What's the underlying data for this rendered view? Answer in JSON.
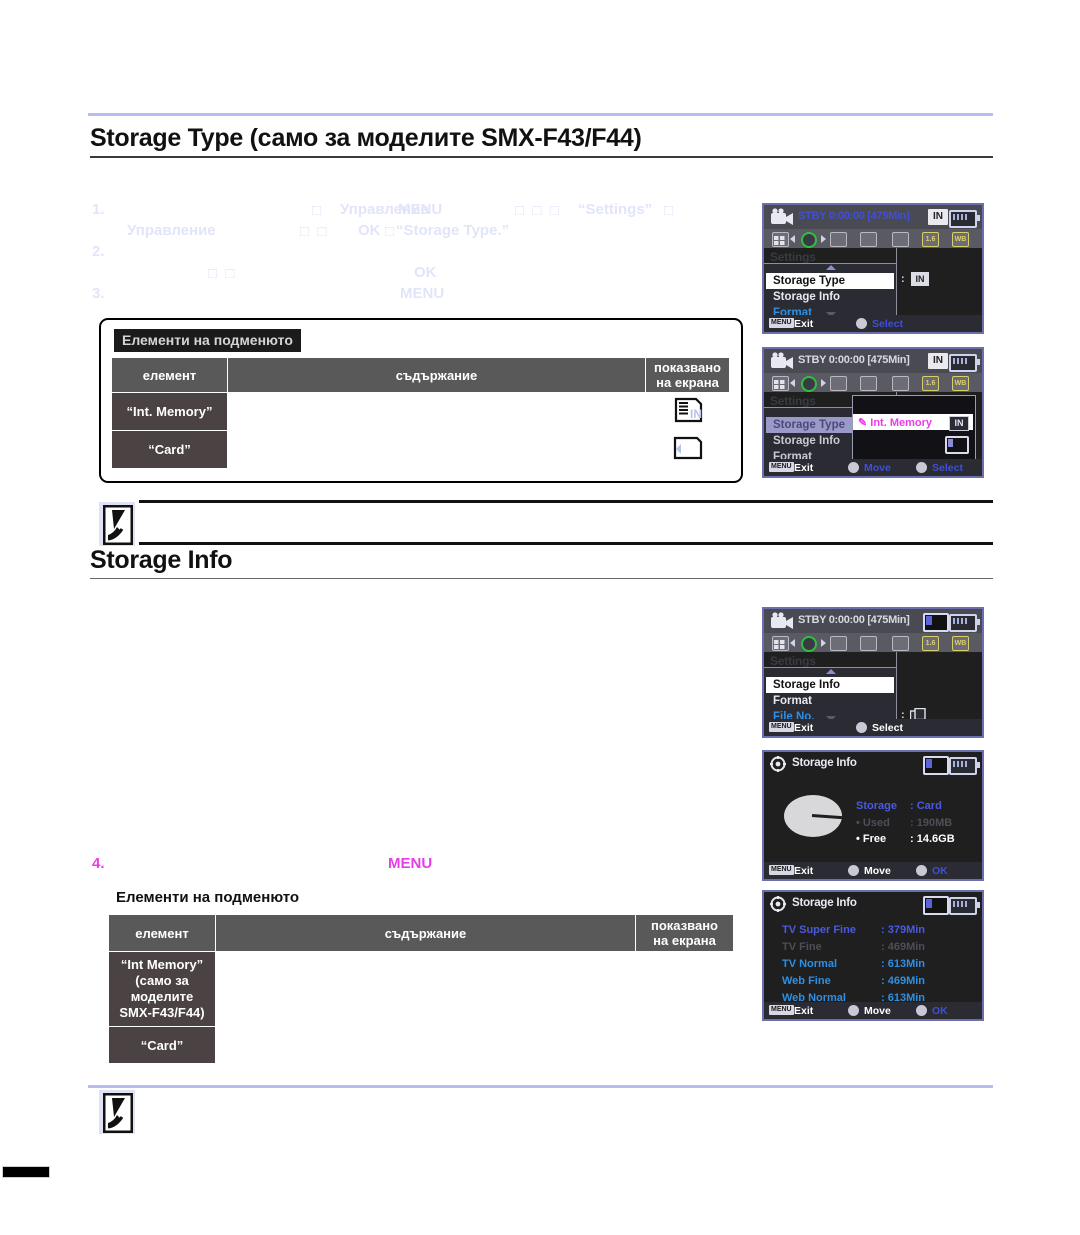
{
  "page": {
    "section1_title": "Storage Type (само за моделите SMX-F43/F44)",
    "section2_title": "Storage Info"
  },
  "steps": [
    {
      "num": "1.",
      "t1": "Управление",
      "t2": "MENU",
      "t3": "“Settings”",
      "t4": "□"
    },
    {
      "num": "",
      "t1": "Управление",
      "t2": "OK",
      "t3": "“Storage Type.”",
      "t4": ""
    },
    {
      "num": "2.",
      "t1": "",
      "t2": "OK",
      "t3": "",
      "t4": ""
    },
    {
      "num": "3.",
      "t1": "",
      "t2": "MENU",
      "t3": "",
      "t4": ""
    },
    {
      "num": "4.",
      "t1": "",
      "t2": "MENU",
      "t3": "",
      "t4": ""
    }
  ],
  "submenu_top": {
    "tag": "Елементи на подменюто",
    "headers": {
      "item": "елемент",
      "content": "съдържание",
      "display": "показвано\nна екрана"
    },
    "header_display_line1": "показвано",
    "header_display_line2": "на екрана",
    "rows": [
      {
        "item": "“Int. Memory”",
        "content": "",
        "icon": "internal-memory-icon"
      },
      {
        "item": "“Card”",
        "content": "",
        "icon": "memory-card-icon"
      }
    ]
  },
  "submenu_bottom": {
    "title": "Елементи на подменюто",
    "headers": {
      "item": "елемент",
      "content": "съдържание"
    },
    "header_display_line1": "показвано",
    "header_display_line2": "на екрана",
    "rows": [
      {
        "item_lines": [
          "“Int Memory”",
          "(само за",
          "моделите",
          "SMX-F43/F44)"
        ],
        "content": ""
      },
      {
        "item_lines": [
          "“Card”"
        ],
        "content": ""
      }
    ],
    "row1_l1": "“Int Memory”",
    "row1_l2": "(само за",
    "row1_l3": "моделите",
    "row1_l4": "SMX-F43/F44)",
    "row2_l1": "“Card”"
  },
  "lcd_common": {
    "stby": "STBY",
    "timecode": "0:00:00",
    "remaining": "[475Min]",
    "in_badge": "IN",
    "settings_label": "Settings",
    "exit_key": "MENU",
    "exit_label": "Exit",
    "select_label": "Select",
    "move_label": "Move",
    "ok_label": "OK",
    "tab_labels": {
      "t5": "1.6",
      "t6": "WB"
    }
  },
  "lcd1": {
    "menu_items": [
      {
        "label": "Storage Type",
        "state": "selected"
      },
      {
        "label": "Storage Info",
        "state": "normal"
      },
      {
        "label": "Format",
        "state": "blue"
      }
    ],
    "value_colon": ":",
    "value_badge": "IN"
  },
  "lcd2": {
    "menu_items": [
      {
        "label": "Storage Type",
        "state": "lavender"
      },
      {
        "label": "Storage Info",
        "state": "dim"
      },
      {
        "label": "Format",
        "state": "dim"
      }
    ],
    "popup_items": [
      {
        "label": "Int. Memory",
        "badge": "IN",
        "state": "selected"
      },
      {
        "label": "",
        "badge": "card",
        "state": "normal"
      }
    ]
  },
  "lcd3": {
    "menu_items": [
      {
        "label": "Storage Info",
        "state": "selected"
      },
      {
        "label": "Format",
        "state": "normal"
      },
      {
        "label": "File No.",
        "state": "blue"
      }
    ],
    "value_colon": ":"
  },
  "lcd4": {
    "title": "Storage Info",
    "rows": [
      {
        "label": "Storage",
        "sep": ":",
        "value": "Card",
        "state": "accent"
      },
      {
        "label": "Used",
        "sep": ":",
        "value": "190MB",
        "state": "dim"
      },
      {
        "label": "Free",
        "sep": ":",
        "value": "14.6GB",
        "state": "white"
      }
    ],
    "bullet": "•"
  },
  "lcd5": {
    "title": "Storage Info",
    "rows": [
      {
        "label": "TV Super Fine",
        "sep": ":",
        "value": "379Min",
        "state": "accent"
      },
      {
        "label": "TV Fine",
        "sep": ":",
        "value": "469Min",
        "state": "dim"
      },
      {
        "label": "TV Normal",
        "sep": ":",
        "value": "613Min",
        "state": "cyan"
      },
      {
        "label": "Web Fine",
        "sep": ":",
        "value": "469Min",
        "state": "cyan"
      },
      {
        "label": "Web Normal",
        "sep": ":",
        "value": "613Min",
        "state": "cyan"
      }
    ]
  },
  "colors": {
    "rule": "#b6bdf0",
    "magenta": "#ea3cea",
    "lcd_blue": "#3f4fd8",
    "lcd_cyan": "#2f8fe0"
  }
}
